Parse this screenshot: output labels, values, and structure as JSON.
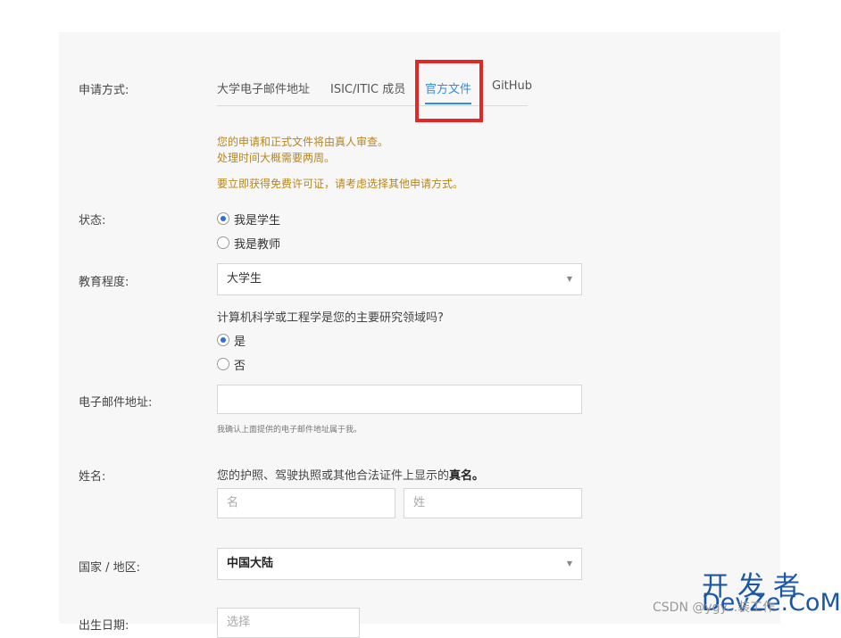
{
  "colors": {
    "accent": "#2d8cf0",
    "note": "#b8861b",
    "annotation_box": "#e32727",
    "watermark": "#1c57a6"
  },
  "form": {
    "application_method": {
      "label": "申请方式:",
      "tabs": [
        "大学电子邮件地址",
        "ISIC/ITIC 成员",
        "官方文件",
        "GitHub"
      ],
      "active_tab": "官方文件"
    },
    "notes": {
      "line1": "您的申请和正式文件将由真人审查。",
      "line2": "处理时间大概需要两周。",
      "line3": "要立即获得免费许可证，请考虑选择其他申请方式。"
    },
    "status": {
      "label": "状态:",
      "options": [
        {
          "text": "我是学生",
          "selected": true
        },
        {
          "text": "我是教师",
          "selected": false
        }
      ]
    },
    "education": {
      "label": "教育程度:",
      "selected": "大学生",
      "caret": "▼",
      "question": "计算机科学或工程学是您的主要研究领域吗?",
      "options": [
        {
          "text": "是",
          "selected": true
        },
        {
          "text": "否",
          "selected": false
        }
      ]
    },
    "email": {
      "label": "电子邮件地址:",
      "value": "",
      "hint": "我确认上面提供的电子邮件地址属于我。"
    },
    "name": {
      "label": "姓名:",
      "hint_prefix": "您的护照、驾驶执照或其他合法证件上显示的",
      "hint_bold": "真名。",
      "first_placeholder": "名",
      "last_placeholder": "姓"
    },
    "country": {
      "label": "国家 / 地区:",
      "selected": "中国大陆",
      "caret": "▼"
    },
    "birth_date": {
      "label": "出生日期:",
      "placeholder": "选择"
    }
  },
  "watermark": {
    "csdn": "CSDN @ygy...装工作",
    "brand_cn": "开发者",
    "brand_en": "DevZe.CoM"
  }
}
